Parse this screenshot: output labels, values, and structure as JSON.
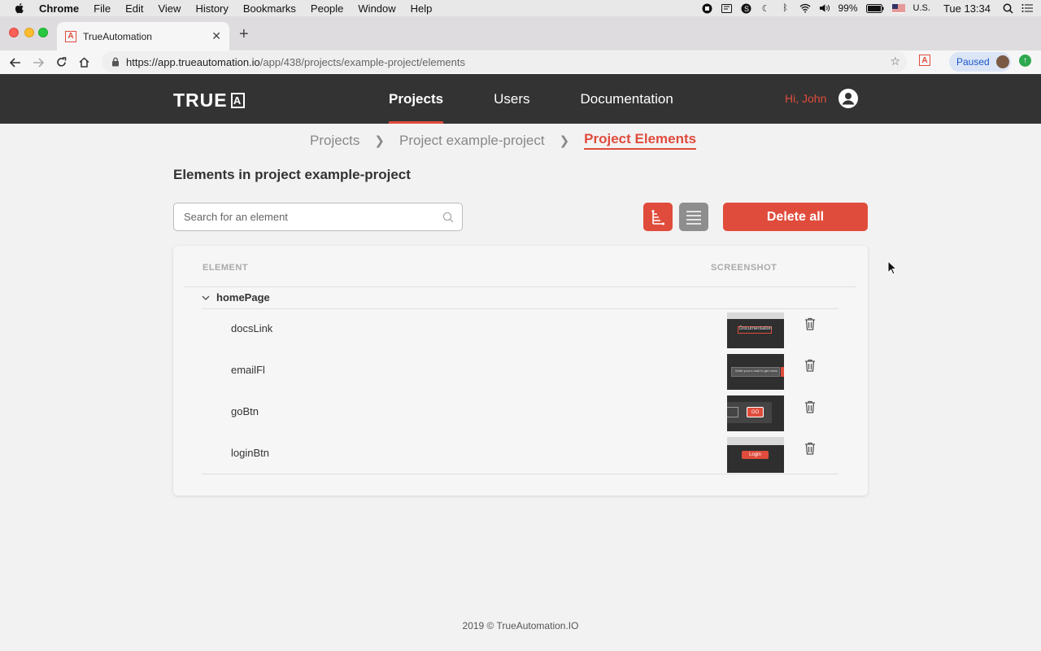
{
  "menubar": {
    "app": "Chrome",
    "items": [
      "File",
      "Edit",
      "View",
      "History",
      "Bookmarks",
      "People",
      "Window",
      "Help"
    ],
    "battery": "99%",
    "input_source": "U.S.",
    "clock": "Tue 13:34"
  },
  "browser": {
    "tab_title": "TrueAutomation",
    "favicon_letter": "A",
    "url_host": "https://app.trueautomation.io",
    "url_path": "/app/438/projects/example-project/elements",
    "profile_label": "Paused"
  },
  "app": {
    "logo_text": "TRUE",
    "logo_box": "A",
    "nav": [
      {
        "label": "Projects",
        "active": true
      },
      {
        "label": "Users",
        "active": false
      },
      {
        "label": "Documentation",
        "active": false
      }
    ],
    "greeting": "Hi, John"
  },
  "breadcrumb": [
    "Projects",
    "Project example-project",
    "Project Elements"
  ],
  "page_title": "Elements in project example-project",
  "search": {
    "placeholder": "Search for an element",
    "value": ""
  },
  "actions": {
    "delete_all": "Delete all"
  },
  "table": {
    "headers": {
      "element": "ELEMENT",
      "screenshot": "SCREENSHOT"
    },
    "group": "homePage",
    "rows": [
      {
        "name": "docsLink"
      },
      {
        "name": "emailFl"
      },
      {
        "name": "goBtn"
      },
      {
        "name": "loginBtn"
      }
    ],
    "thumb_texts": {
      "docs": "Documentation",
      "email": "Write your e-mail to get news",
      "go": "GO",
      "login": "Login"
    }
  },
  "footer": "2019 © TrueAutomation.IO",
  "colors": {
    "accent": "#e04c3c",
    "header_bg": "#333333",
    "page_bg": "#f3f2f3"
  }
}
